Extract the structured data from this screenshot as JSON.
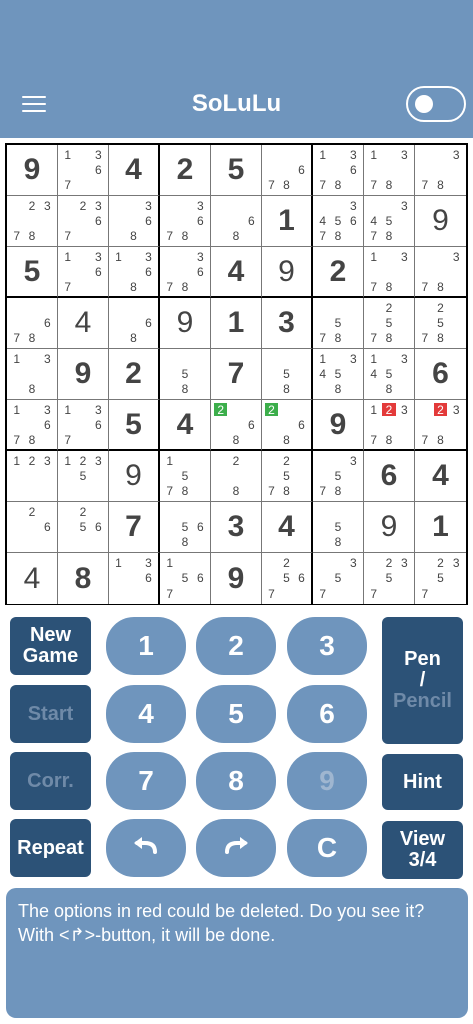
{
  "header": {
    "title": "SoLuLu",
    "menu_icon": "hamburger-menu-icon",
    "toggle_state": "off"
  },
  "colors": {
    "header": "#6f95bd",
    "dark_button": "#2c5277",
    "pill_button": "#6f95bd",
    "hint_green": "#3cae4b",
    "hint_red": "#e33a3a"
  },
  "board": {
    "cells": [
      [
        {
          "v": "9",
          "given": true
        },
        {
          "c": [
            "1",
            "",
            "3",
            "",
            "",
            "6",
            "7",
            "",
            ""
          ]
        },
        {
          "v": "4",
          "given": true
        },
        {
          "v": "2",
          "given": true
        },
        {
          "v": "5",
          "given": true
        },
        {
          "c": [
            "",
            "",
            "",
            "",
            "",
            "6",
            "7",
            "8",
            ""
          ]
        },
        {
          "c": [
            "1",
            "",
            "3",
            "",
            "",
            "6",
            "7",
            "8",
            ""
          ]
        },
        {
          "c": [
            "1",
            "",
            "3",
            "",
            "",
            "",
            "7",
            "8",
            ""
          ]
        },
        {
          "c": [
            "",
            "",
            "3",
            "",
            "",
            "",
            "7",
            "8",
            ""
          ]
        }
      ],
      [
        {
          "c": [
            "",
            "2",
            "3",
            "",
            "",
            "",
            "7",
            "8",
            ""
          ]
        },
        {
          "c": [
            "",
            "2",
            "3",
            "",
            "",
            "6",
            "7",
            "",
            ""
          ]
        },
        {
          "c": [
            "",
            "",
            "3",
            "",
            "",
            "6",
            "",
            "8",
            ""
          ]
        },
        {
          "c": [
            "",
            "",
            "3",
            "",
            "",
            "6",
            "7",
            "8",
            ""
          ]
        },
        {
          "c": [
            "",
            "",
            "",
            "",
            "",
            "6",
            "",
            "8",
            ""
          ]
        },
        {
          "v": "1",
          "given": true
        },
        {
          "c": [
            "",
            "",
            "3",
            "4",
            "5",
            "6",
            "7",
            "8",
            ""
          ]
        },
        {
          "c": [
            "",
            "",
            "3",
            "4",
            "5",
            "",
            "7",
            "8",
            ""
          ]
        },
        {
          "v": "9",
          "given": false
        }
      ],
      [
        {
          "v": "5",
          "given": true
        },
        {
          "c": [
            "1",
            "",
            "3",
            "",
            "",
            "6",
            "7",
            "",
            ""
          ]
        },
        {
          "c": [
            "1",
            "",
            "3",
            "",
            "",
            "6",
            "",
            "8",
            ""
          ]
        },
        {
          "c": [
            "",
            "",
            "3",
            "",
            "",
            "6",
            "7",
            "8",
            ""
          ]
        },
        {
          "v": "4",
          "given": true
        },
        {
          "v": "9",
          "given": false
        },
        {
          "v": "2",
          "given": true
        },
        {
          "c": [
            "1",
            "",
            "3",
            "",
            "",
            "",
            "7",
            "8",
            ""
          ]
        },
        {
          "c": [
            "",
            "",
            "3",
            "",
            "",
            "",
            "7",
            "8",
            ""
          ]
        }
      ],
      [
        {
          "c": [
            "",
            "",
            "",
            "",
            "",
            "6",
            "7",
            "8",
            ""
          ]
        },
        {
          "v": "4",
          "given": false
        },
        {
          "c": [
            "",
            "",
            "",
            "",
            "",
            "6",
            "",
            "8",
            ""
          ]
        },
        {
          "v": "9",
          "given": false
        },
        {
          "v": "1",
          "given": true
        },
        {
          "v": "3",
          "given": true
        },
        {
          "c": [
            "",
            "",
            "",
            "",
            "5",
            "",
            "7",
            "8",
            ""
          ]
        },
        {
          "c": [
            "",
            "2",
            "",
            "",
            "5",
            "",
            "7",
            "8",
            ""
          ]
        },
        {
          "c": [
            "",
            "2",
            "",
            "",
            "5",
            "",
            "7",
            "8",
            ""
          ]
        }
      ],
      [
        {
          "c": [
            "1",
            "",
            "3",
            "",
            "",
            "",
            "",
            "8",
            ""
          ]
        },
        {
          "v": "9",
          "given": true
        },
        {
          "v": "2",
          "given": true
        },
        {
          "c": [
            "",
            "",
            "",
            "",
            "5",
            "",
            "",
            "8",
            ""
          ]
        },
        {
          "v": "7",
          "given": true
        },
        {
          "c": [
            "",
            "",
            "",
            "",
            "5",
            "",
            "",
            "8",
            ""
          ]
        },
        {
          "c": [
            "1",
            "",
            "3",
            "4",
            "5",
            "",
            "",
            "8",
            ""
          ]
        },
        {
          "c": [
            "1",
            "",
            "3",
            "4",
            "5",
            "",
            "",
            "8",
            ""
          ]
        },
        {
          "v": "6",
          "given": true
        }
      ],
      [
        {
          "c": [
            "1",
            "",
            "3",
            "",
            "",
            "6",
            "7",
            "8",
            ""
          ]
        },
        {
          "c": [
            "1",
            "",
            "3",
            "",
            "",
            "6",
            "7",
            "",
            ""
          ]
        },
        {
          "v": "5",
          "given": true
        },
        {
          "v": "4",
          "given": true
        },
        {
          "c": [
            {
              "t": "2",
              "h": "green"
            },
            "",
            "",
            "",
            "",
            "6",
            "",
            "8",
            ""
          ]
        },
        {
          "c": [
            {
              "t": "2",
              "h": "green"
            },
            "",
            "",
            "",
            "",
            "6",
            "",
            "8",
            ""
          ]
        },
        {
          "v": "9",
          "given": true
        },
        {
          "c": [
            "1",
            {
              "t": "2",
              "h": "red"
            },
            "3",
            "",
            "",
            "",
            "7",
            "8",
            ""
          ]
        },
        {
          "c": [
            "",
            {
              "t": "2",
              "h": "red"
            },
            "3",
            "",
            "",
            "",
            "7",
            "8",
            ""
          ]
        }
      ],
      [
        {
          "c": [
            "1",
            "2",
            "3",
            "",
            "",
            "",
            "",
            "",
            ""
          ]
        },
        {
          "c": [
            "1",
            "2",
            "3",
            "",
            "5",
            "",
            "",
            "",
            ""
          ]
        },
        {
          "v": "9",
          "given": false
        },
        {
          "c": [
            "1",
            "",
            "",
            "",
            "5",
            "",
            "7",
            "8",
            ""
          ]
        },
        {
          "c": [
            "",
            "2",
            "",
            "",
            "",
            "",
            "",
            "8",
            ""
          ]
        },
        {
          "c": [
            "",
            "2",
            "",
            "",
            "5",
            "",
            "7",
            "8",
            ""
          ]
        },
        {
          "c": [
            "",
            "",
            "3",
            "",
            "5",
            "",
            "7",
            "8",
            ""
          ]
        },
        {
          "v": "6",
          "given": true
        },
        {
          "v": "4",
          "given": true
        }
      ],
      [
        {
          "c": [
            "",
            "2",
            "",
            "",
            "",
            "6",
            "",
            "",
            ""
          ]
        },
        {
          "c": [
            "",
            "2",
            "",
            "",
            "5",
            "6",
            "",
            "",
            ""
          ]
        },
        {
          "v": "7",
          "given": true
        },
        {
          "c": [
            "",
            "",
            "",
            "",
            "5",
            "6",
            "",
            "8",
            ""
          ]
        },
        {
          "v": "3",
          "given": true
        },
        {
          "v": "4",
          "given": true
        },
        {
          "c": [
            "",
            "",
            "",
            "",
            "5",
            "",
            "",
            "8",
            ""
          ]
        },
        {
          "v": "9",
          "given": false
        },
        {
          "v": "1",
          "given": true
        }
      ],
      [
        {
          "v": "4",
          "given": false
        },
        {
          "v": "8",
          "given": true
        },
        {
          "c": [
            "1",
            "",
            "3",
            "",
            "",
            "6",
            "",
            "",
            ""
          ]
        },
        {
          "c": [
            "1",
            "",
            "",
            "",
            "5",
            "6",
            "7",
            "",
            ""
          ]
        },
        {
          "v": "9",
          "given": true
        },
        {
          "c": [
            "",
            "2",
            "",
            "",
            "5",
            "6",
            "7",
            "",
            ""
          ]
        },
        {
          "c": [
            "",
            "",
            "3",
            "",
            "5",
            "",
            "7",
            "",
            ""
          ]
        },
        {
          "c": [
            "",
            "2",
            "3",
            "",
            "5",
            "",
            "7",
            "",
            ""
          ]
        },
        {
          "c": [
            "",
            "2",
            "3",
            "",
            "5",
            "",
            "7",
            "",
            ""
          ]
        }
      ]
    ]
  },
  "controls": {
    "new_game": "New Game",
    "start": "Start",
    "corr": "Corr.",
    "repeat": "Repeat",
    "pen": "Pen",
    "slash": "/",
    "pencil": "Pencil",
    "hint": "Hint",
    "view": "View 3/4",
    "digits": [
      "1",
      "2",
      "3",
      "4",
      "5",
      "6",
      "7",
      "8",
      "9"
    ],
    "undo_icon": "undo-arrow-icon",
    "redo_icon": "redo-arrow-icon",
    "clear": "C"
  },
  "message": {
    "text": "The options in red could be deleted. Do you see it? With <↱>-button, it will be done."
  }
}
